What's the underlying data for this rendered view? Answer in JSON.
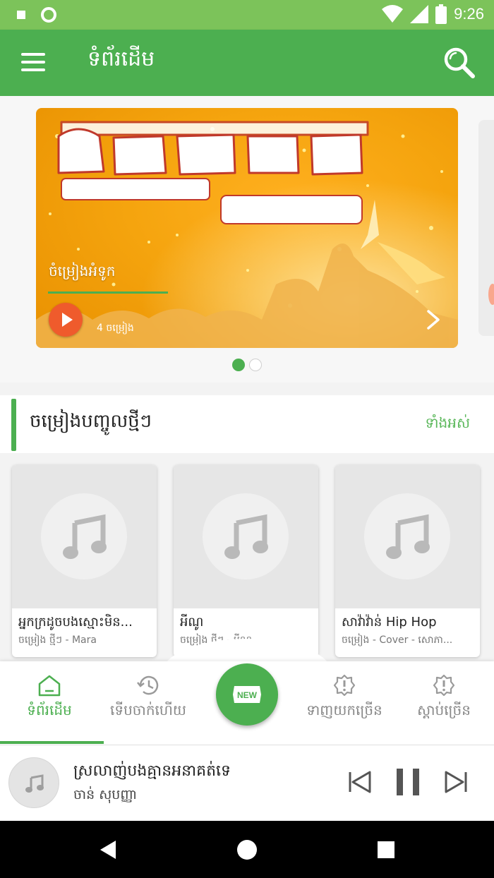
{
  "status_bar": {
    "time": "9:26"
  },
  "app_bar": {
    "title": "ទំព័រដើម"
  },
  "banner": {
    "title": "ចំម្រៀងអំទូក",
    "count": "4 ចម្រៀង",
    "slides": 2,
    "active_slide": 1,
    "background_color": "#f5a40e"
  },
  "section": {
    "title": "ចម្រៀងបញ្ចូលថ្មីៗ",
    "see_all": "ទាំងអស់"
  },
  "cards": [
    {
      "title": "អ្នកក្រដូចបងស្មោះមិន...",
      "subtitle": "ចម្រៀង ថ្មីៗ - Mara"
    },
    {
      "title": "អីណូ",
      "subtitle": "ចម្រៀង ថ្មីៗ - អីណូ"
    },
    {
      "title": "សាវ៉ាវ៉ាន់ Hip Hop",
      "subtitle": "ចម្រៀង - Cover - សោភា..."
    }
  ],
  "bottom_nav": {
    "items": [
      {
        "label": "ទំព័រដើម",
        "icon": "home-icon",
        "active": true
      },
      {
        "label": "ទើបចាក់ហើយ",
        "icon": "history-icon",
        "active": false
      },
      {
        "label": "ទាញយកច្រើន",
        "icon": "alert-badge-icon",
        "active": false
      },
      {
        "label": "ស្តាប់ច្រើន",
        "icon": "alert-badge-icon",
        "active": false
      }
    ],
    "fab_label": "NEW"
  },
  "player": {
    "title": "ស្រលាញ់បងគ្មានអនាគត់ទេ",
    "artist": "ចាន់ សុបញ្ញា",
    "state": "playing"
  },
  "colors": {
    "primary": "#4caf50",
    "status_bar": "#7cc35a",
    "play_button": "#ef5b2c"
  }
}
